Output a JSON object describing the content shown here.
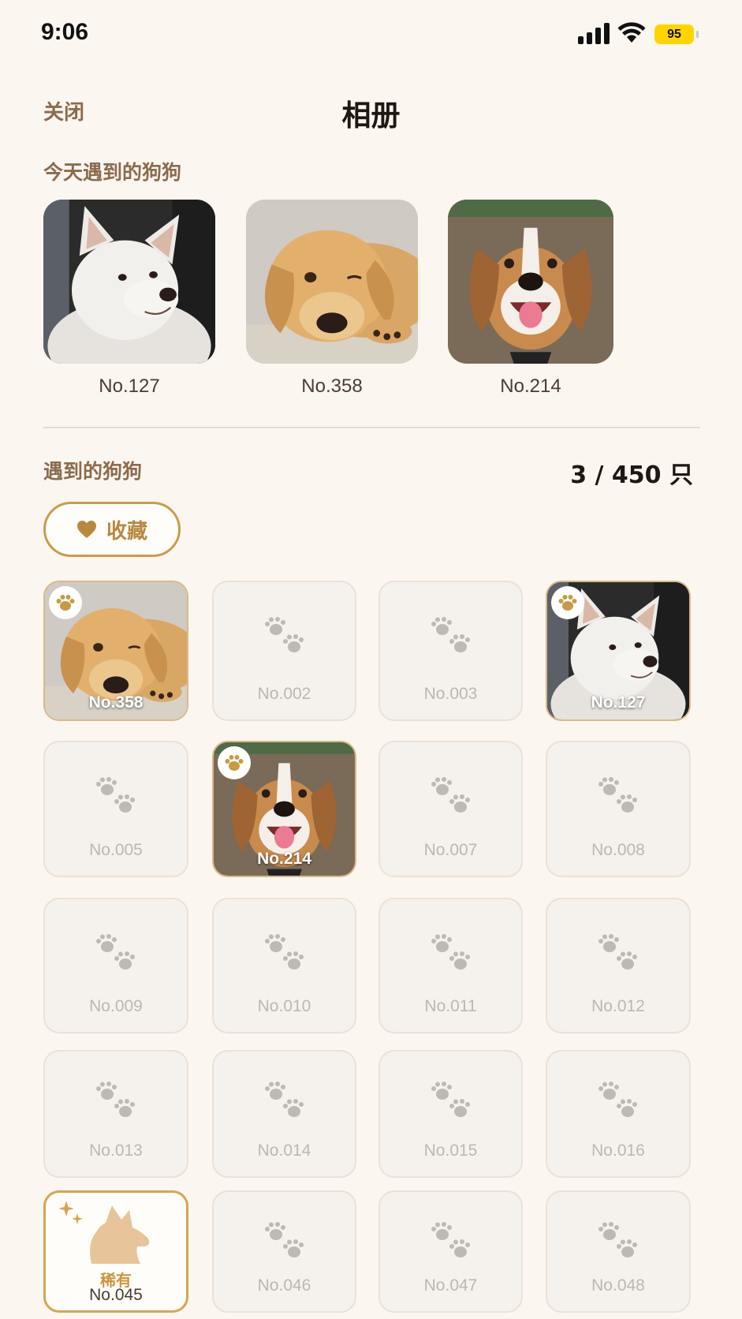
{
  "status": {
    "time": "9:06",
    "battery": "95"
  },
  "header": {
    "close_label": "关闭",
    "title": "相册"
  },
  "today": {
    "title": "今天遇到的狗狗",
    "dogs": [
      {
        "label": "No.127",
        "breed": "white-shiba"
      },
      {
        "label": "No.358",
        "breed": "golden-retriever"
      },
      {
        "label": "No.214",
        "breed": "beagle"
      }
    ]
  },
  "collection": {
    "title": "遇到的狗狗",
    "count": "3 / 450 只",
    "favorites_label": "收藏",
    "rare_label": "稀有",
    "items": [
      {
        "label": "No.358",
        "state": "photo",
        "breed": "golden-retriever"
      },
      {
        "label": "No.002",
        "state": "locked"
      },
      {
        "label": "No.003",
        "state": "locked"
      },
      {
        "label": "No.127",
        "state": "photo",
        "breed": "white-shiba"
      },
      {
        "label": "No.005",
        "state": "locked"
      },
      {
        "label": "No.214",
        "state": "photo",
        "breed": "beagle"
      },
      {
        "label": "No.007",
        "state": "locked"
      },
      {
        "label": "No.008",
        "state": "locked"
      },
      {
        "label": "No.009",
        "state": "locked"
      },
      {
        "label": "No.010",
        "state": "locked"
      },
      {
        "label": "No.011",
        "state": "locked"
      },
      {
        "label": "No.012",
        "state": "locked"
      },
      {
        "label": "No.013",
        "state": "locked"
      },
      {
        "label": "No.014",
        "state": "locked"
      },
      {
        "label": "No.015",
        "state": "locked"
      },
      {
        "label": "No.016",
        "state": "locked"
      },
      {
        "label": "No.045",
        "state": "rare"
      },
      {
        "label": "No.046",
        "state": "locked"
      },
      {
        "label": "No.047",
        "state": "locked"
      },
      {
        "label": "No.048",
        "state": "locked"
      }
    ]
  },
  "colors": {
    "background": "#fcf6f0",
    "accent": "#c99c4a",
    "muted_text": "#8b6b4e"
  }
}
